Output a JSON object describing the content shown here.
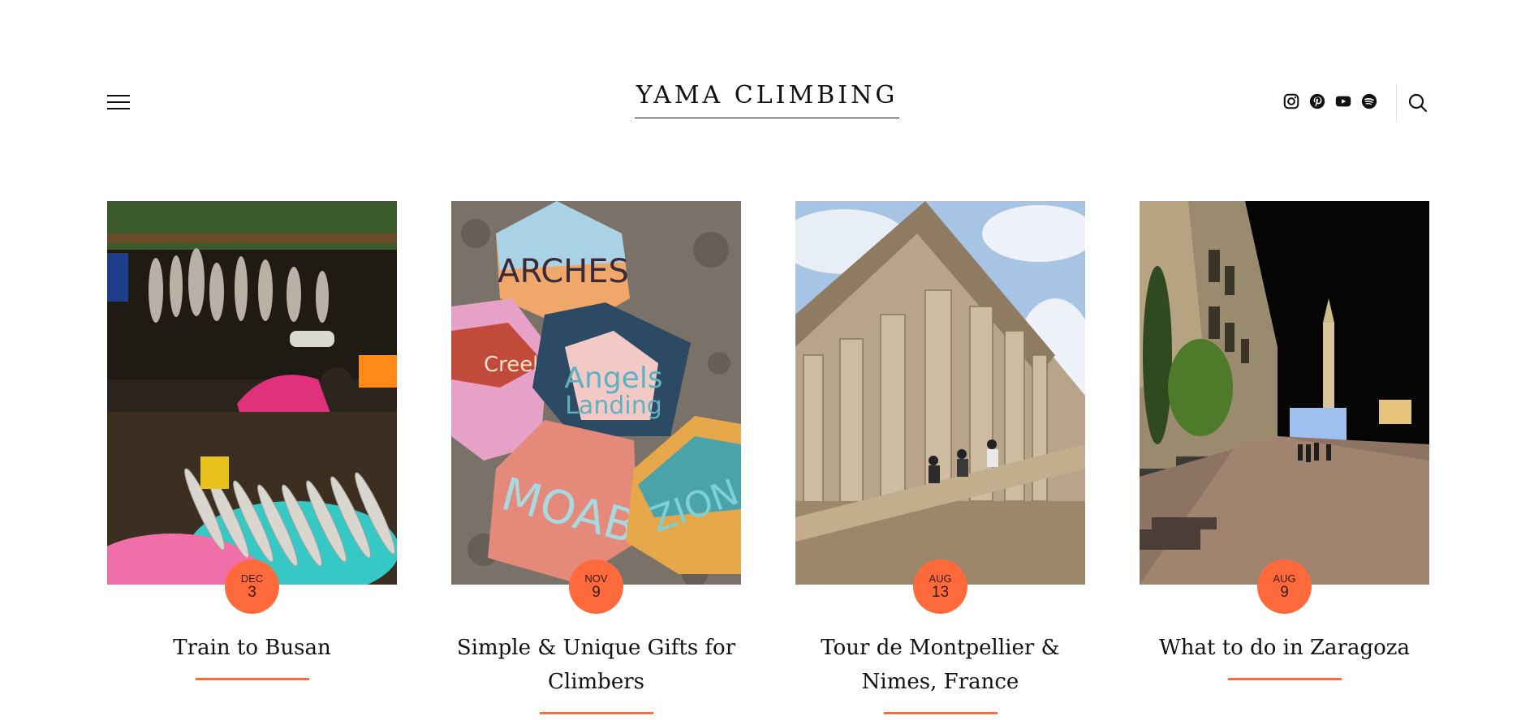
{
  "header": {
    "site_title": "YAMA CLIMBING",
    "menu_icon": "hamburger-menu-icon",
    "social_icons": [
      "instagram-icon",
      "pinterest-icon",
      "youtube-icon",
      "spotify-icon"
    ],
    "search_icon": "search-icon"
  },
  "theme": {
    "accent": "#ff6a3d",
    "text": "#111111"
  },
  "posts": [
    {
      "month": "DEC",
      "day": "3",
      "title": "Train to Busan"
    },
    {
      "month": "NOV",
      "day": "9",
      "title": "Simple & Unique Gifts for Climbers"
    },
    {
      "month": "AUG",
      "day": "13",
      "title": "Tour de Montpellier & Nimes, France"
    },
    {
      "month": "AUG",
      "day": "9",
      "title": "What to do in Zaragoza"
    }
  ]
}
